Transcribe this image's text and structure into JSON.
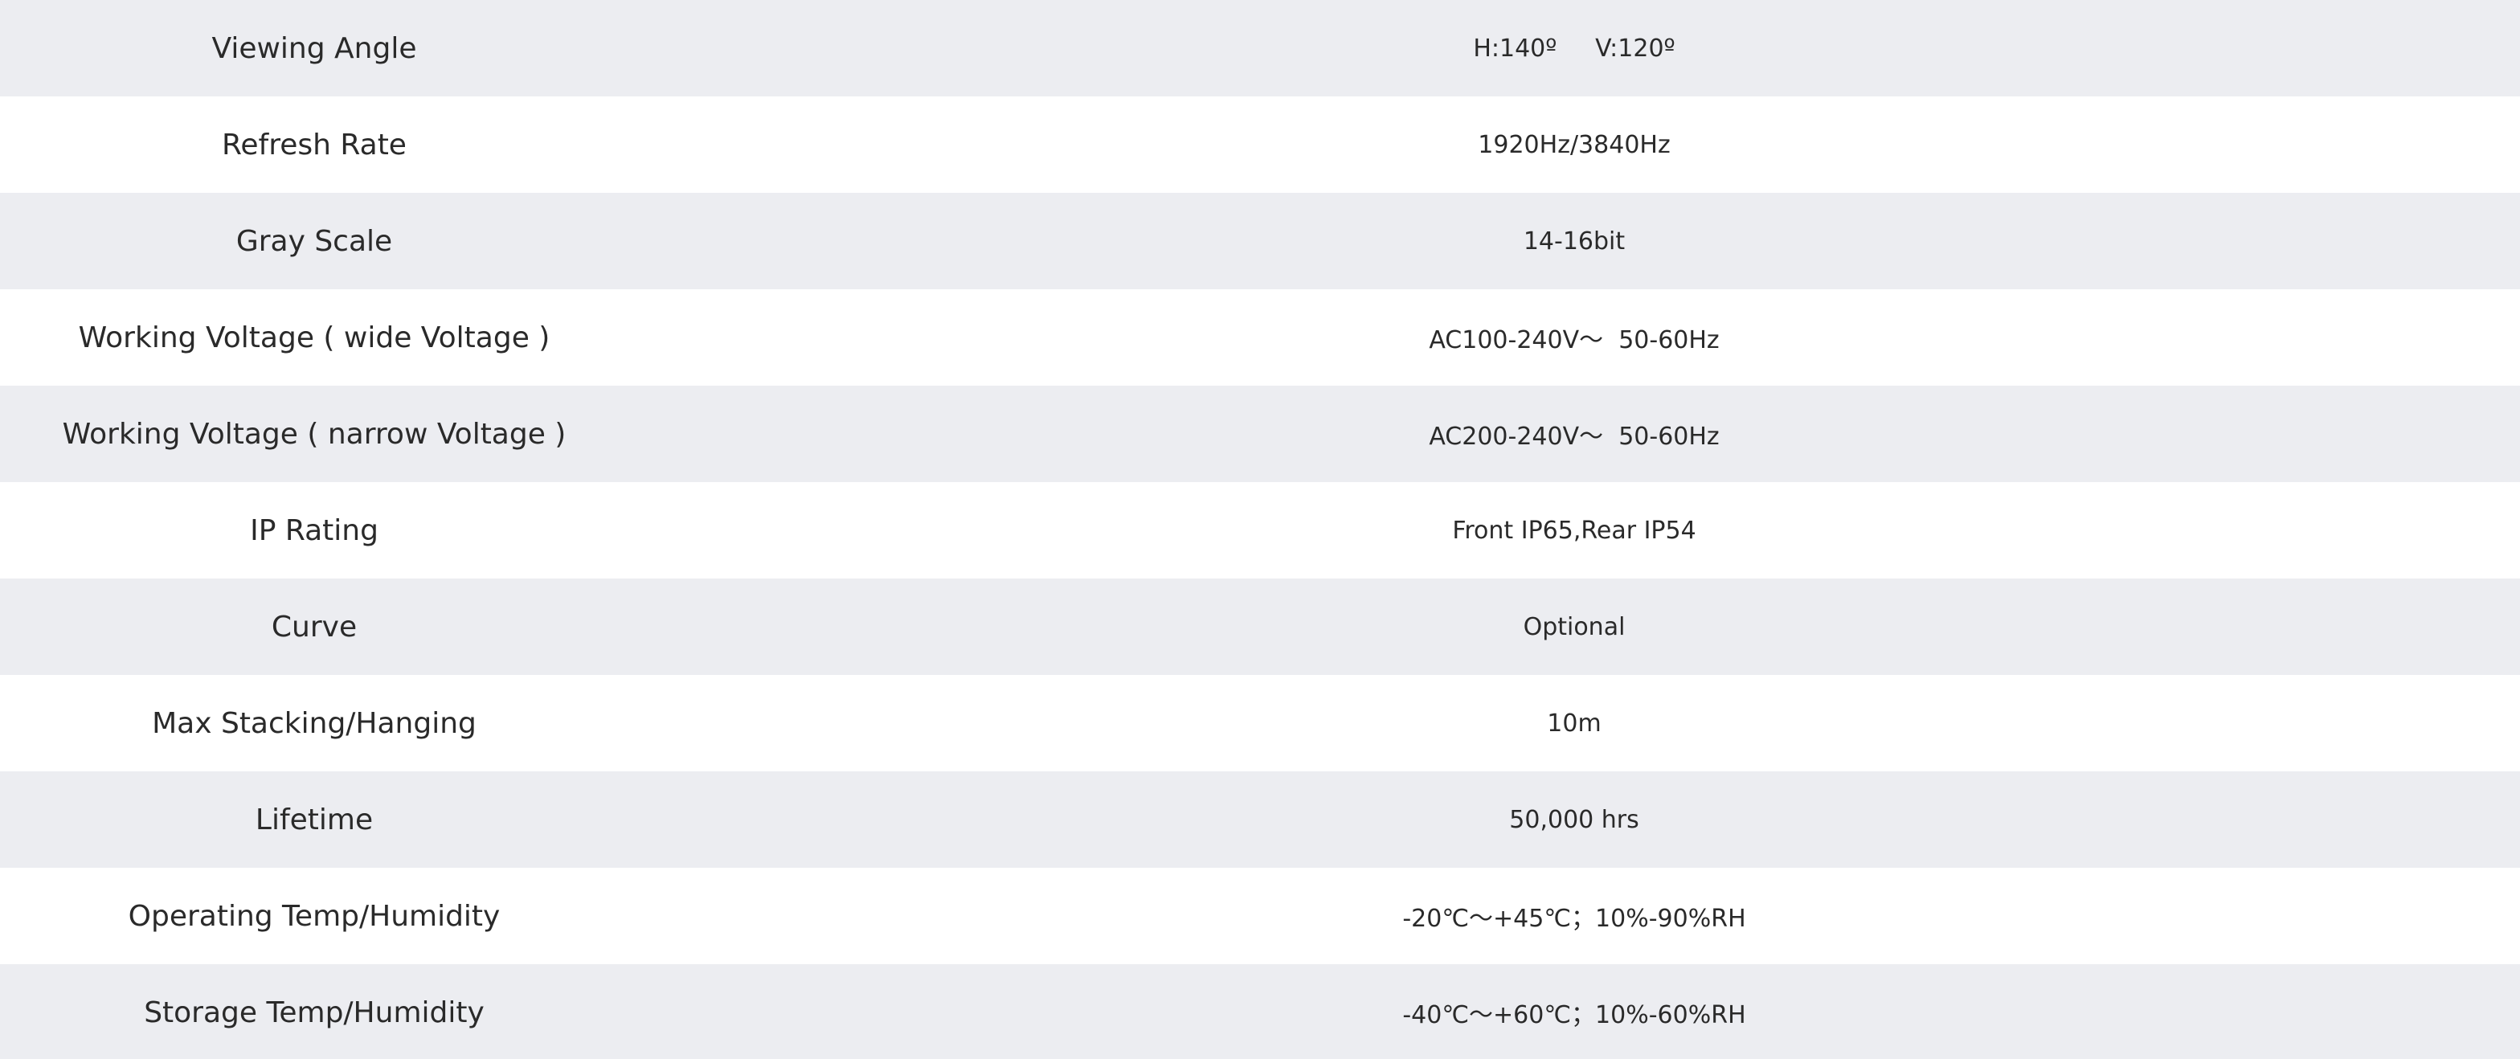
{
  "spec_table": {
    "rows": [
      {
        "label": "Viewing Angle",
        "value": "H:140º     V:120º"
      },
      {
        "label": "Refresh Rate",
        "value": "1920Hz/3840Hz"
      },
      {
        "label": "Gray Scale",
        "value": "14-16bit"
      },
      {
        "label": "Working Voltage ( wide Voltage )",
        "value": "AC100-240V～  50-60Hz"
      },
      {
        "label": "Working Voltage ( narrow Voltage )",
        "value": "AC200-240V～  50-60Hz"
      },
      {
        "label": "IP Rating",
        "value": "Front IP65,Rear IP54"
      },
      {
        "label": "Curve",
        "value": "Optional"
      },
      {
        "label": "Max Stacking/Hanging",
        "value": "10m"
      },
      {
        "label": "Lifetime",
        "value": "50,000 hrs"
      },
      {
        "label": "Operating Temp/Humidity",
        "value": "-20℃～+45℃；10%-90%RH"
      },
      {
        "label": "Storage Temp/Humidity",
        "value": "-40℃～+60℃；10%-60%RH"
      }
    ]
  },
  "colors": {
    "row_shaded": "#ecedf1",
    "row_plain": "#ffffff",
    "text": "#2a2a2a"
  }
}
